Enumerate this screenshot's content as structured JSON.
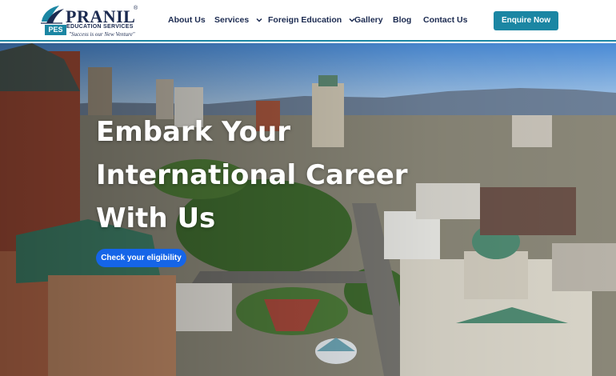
{
  "header": {
    "logo": {
      "brand": "PRANIL",
      "reg": "®",
      "subtitle": "EDUCATION SERVICES",
      "tagline": "\"Success is our New Venture\"",
      "badge": "PES"
    },
    "nav": [
      {
        "label": "About Us",
        "has_dropdown": false
      },
      {
        "label": "Services",
        "has_dropdown": true
      },
      {
        "label": "Foreign Education",
        "has_dropdown": true
      },
      {
        "label": "Gallery",
        "has_dropdown": false
      },
      {
        "label": "Blog",
        "has_dropdown": false
      },
      {
        "label": "Contact Us",
        "has_dropdown": false
      }
    ],
    "cta_label": "Enquire Now"
  },
  "hero": {
    "title": "Embark Your International Career With Us",
    "button_label": "Check your eligibility"
  },
  "colors": {
    "accent": "#1b86a3",
    "navy": "#1b2a50",
    "hero_button": "#1565e8"
  }
}
